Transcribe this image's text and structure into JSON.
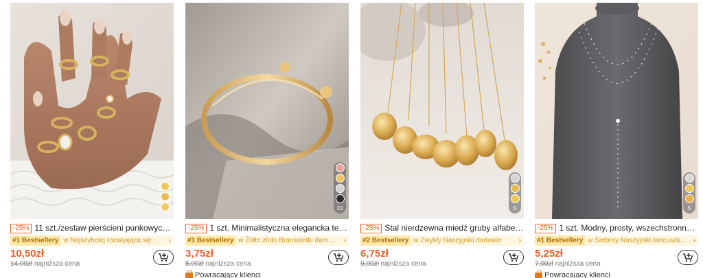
{
  "products": [
    {
      "discount": "-25%",
      "title": "11 szt./zestaw pierścieni punkowych ...",
      "bestseller_tag": "#1 Bestsellery",
      "bestseller_text": "w Najszybciej rozwijająca się ...",
      "price": "10,50zł",
      "original_price": "14,00zł",
      "lowest_label": "najniższa cena",
      "returning": "",
      "swatch_colors": [
        "#f0c75c",
        "#e9bd4e",
        "#f2c964"
      ],
      "swatch_count": ""
    },
    {
      "discount": "-25%",
      "title": "1 szt. Minimalistyczna elegancka tek...",
      "bestseller_tag": "#1 Bestsellery",
      "bestseller_text": "w Żółte złoto Bransoletki dam...",
      "price": "3,75zł",
      "original_price": "5,00zł",
      "lowest_label": "najniższa cena",
      "returning": "Powracający klienci",
      "swatch_colors": [
        "#e8a39a",
        "#f0c75c",
        "#d2d2d2",
        "#2d2d2d"
      ],
      "swatch_count": "20"
    },
    {
      "discount": "-25%",
      "title": "Stal nierdzewna miedź gruby alfabet ...",
      "bestseller_tag": "#2 Bestsellery",
      "bestseller_text": "w Zwykły Naszyjniki damskie",
      "price": "6,75zł",
      "original_price": "9,00zł",
      "lowest_label": "najniższa cena",
      "returning": "",
      "swatch_colors": [
        "#d4d4d4",
        "#e7b955",
        "#f0c75c"
      ],
      "swatch_count": "5"
    },
    {
      "discount": "-25%",
      "title": "1 szt. Modny, prosty, wszechstronny ...",
      "bestseller_tag": "#1 Bestsellery",
      "bestseller_text": "w Srebrny Naszyjniki łańcuszk...",
      "price": "5,25zł",
      "original_price": "7,00zł",
      "lowest_label": "najniższa cena",
      "returning": "Powracający klienci",
      "swatch_colors": [
        "#d8d8d8",
        "#f0c75c",
        "#e5b04c"
      ],
      "swatch_count": "5"
    }
  ],
  "icons": {
    "cart": "add-to-cart-icon",
    "returning": "bag-icon",
    "arrow": "chevron-right-icon"
  },
  "chevron": "›"
}
